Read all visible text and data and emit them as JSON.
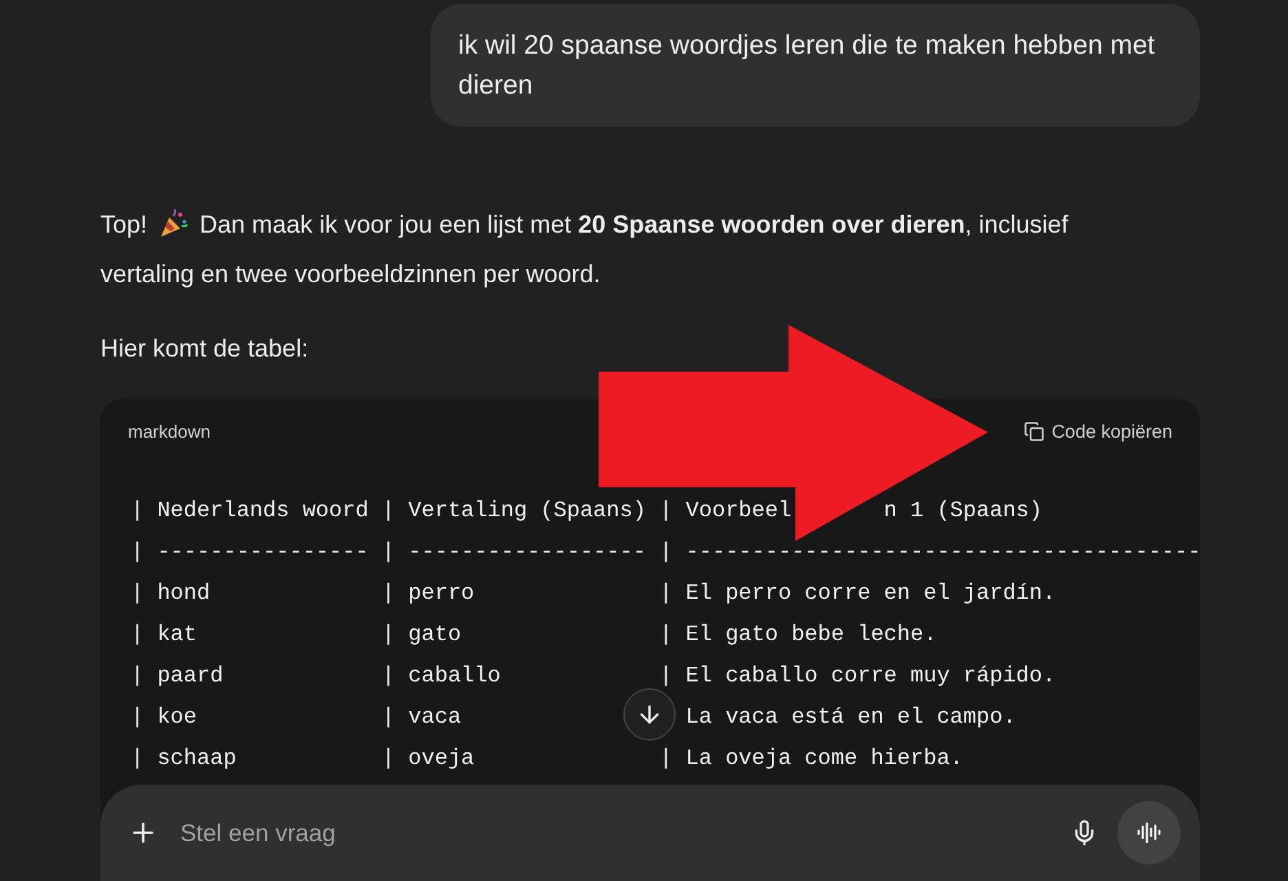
{
  "user_message": "ik wil 20 spaanse woordjes leren die te maken hebben met dieren",
  "assistant": {
    "lead": "Top!",
    "text_lines": [
      "Dan maak ik voor jou een lijst met **20 Spaanse woorden over dieren**, inclusief",
      "vertaling en twee voorbeeldzinnen per woord."
    ],
    "intro": "Hier komt de tabel:"
  },
  "code_block": {
    "language": "markdown",
    "copy_label": "Code kopiëren",
    "lines": [
      {
        "kind": "header",
        "parts": [
          "| Nederlands woord | Vertaling (Spaans) | Voorbeel",
          "n 1 (Spaans)"
        ]
      },
      {
        "parts": [
          "| ---------------- | ------------------ | ---------------------------------------"
        ]
      },
      {
        "parts": [
          "| hond             | perro              | El perro corre en el jardín."
        ]
      },
      {
        "parts": [
          "| kat              | gato               | El gato bebe leche."
        ]
      },
      {
        "parts": [
          "| paard            | caballo            | El caballo corre muy rápido."
        ]
      },
      {
        "kind": "row",
        "parts": [
          "| koe              | vaca",
          "La vaca está en el campo."
        ]
      },
      {
        "parts": [
          "| schaap           | oveja              | La oveja come hierba."
        ]
      }
    ]
  },
  "composer": {
    "placeholder": "Stel een vraag"
  }
}
